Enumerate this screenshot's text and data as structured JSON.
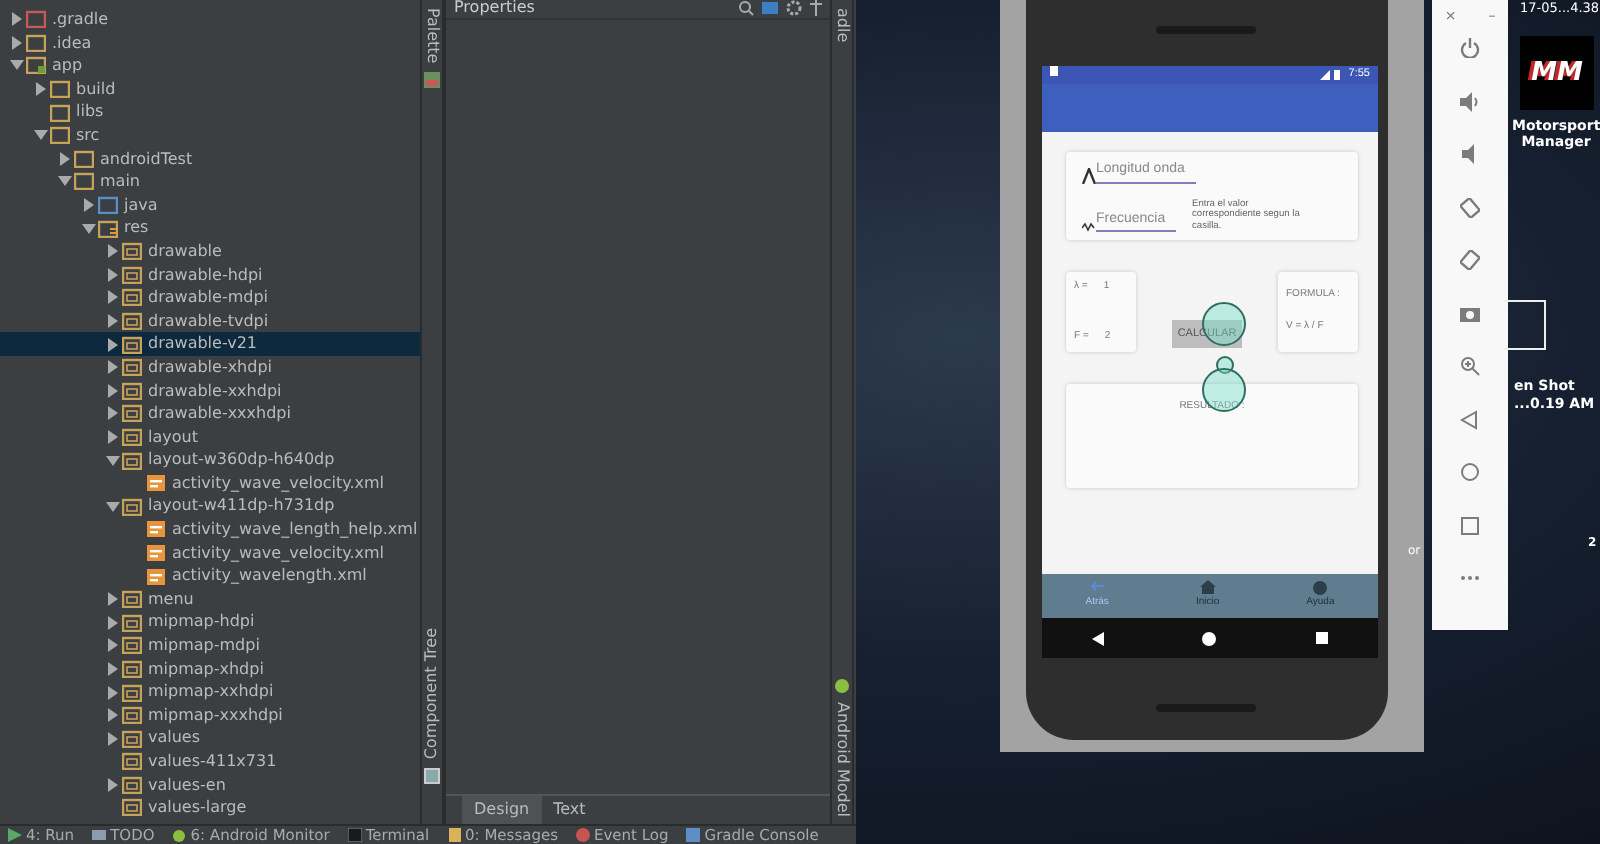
{
  "project_tree": [
    {
      "label": ".gradle",
      "kind": "gradle-folder",
      "expandable": true,
      "expanded": false,
      "selected": false
    },
    {
      "label": ".idea",
      "kind": "folder",
      "expandable": true,
      "expanded": false,
      "selected": false
    },
    {
      "label": "app",
      "kind": "module",
      "expandable": true,
      "expanded": true,
      "selected": false,
      "children": [
        {
          "label": "build",
          "kind": "folder",
          "expandable": true,
          "expanded": false,
          "selected": false
        },
        {
          "label": "libs",
          "kind": "folder",
          "expandable": false,
          "selected": false
        },
        {
          "label": "src",
          "kind": "folder",
          "expandable": true,
          "expanded": true,
          "selected": false,
          "children": [
            {
              "label": "androidTest",
              "kind": "folder",
              "expandable": true,
              "expanded": false,
              "selected": false
            },
            {
              "label": "main",
              "kind": "folder",
              "expandable": true,
              "expanded": true,
              "selected": false,
              "children": [
                {
                  "label": "java",
                  "kind": "source-folder",
                  "expandable": true,
                  "expanded": false,
                  "selected": false
                },
                {
                  "label": "res",
                  "kind": "resource-folder",
                  "expandable": true,
                  "expanded": true,
                  "selected": false,
                  "children": [
                    {
                      "label": "drawable",
                      "kind": "package",
                      "expandable": true,
                      "expanded": false,
                      "selected": false
                    },
                    {
                      "label": "drawable-hdpi",
                      "kind": "package",
                      "expandable": true,
                      "expanded": false,
                      "selected": false
                    },
                    {
                      "label": "drawable-mdpi",
                      "kind": "package",
                      "expandable": true,
                      "expanded": false,
                      "selected": false
                    },
                    {
                      "label": "drawable-tvdpi",
                      "kind": "package",
                      "expandable": true,
                      "expanded": false,
                      "selected": false
                    },
                    {
                      "label": "drawable-v21",
                      "kind": "package",
                      "expandable": true,
                      "expanded": false,
                      "selected": true
                    },
                    {
                      "label": "drawable-xhdpi",
                      "kind": "package",
                      "expandable": true,
                      "expanded": false,
                      "selected": false
                    },
                    {
                      "label": "drawable-xxhdpi",
                      "kind": "package",
                      "expandable": true,
                      "expanded": false,
                      "selected": false
                    },
                    {
                      "label": "drawable-xxxhdpi",
                      "kind": "package",
                      "expandable": true,
                      "expanded": false,
                      "selected": false
                    },
                    {
                      "label": "layout",
                      "kind": "package",
                      "expandable": true,
                      "expanded": false,
                      "selected": false
                    },
                    {
                      "label": "layout-w360dp-h640dp",
                      "kind": "package",
                      "expandable": true,
                      "expanded": true,
                      "selected": false,
                      "children": [
                        {
                          "label": "activity_wave_velocity.xml",
                          "kind": "xml-file",
                          "expandable": false,
                          "selected": false
                        }
                      ]
                    },
                    {
                      "label": "layout-w411dp-h731dp",
                      "kind": "package",
                      "expandable": true,
                      "expanded": true,
                      "selected": false,
                      "children": [
                        {
                          "label": "activity_wave_length_help.xml",
                          "kind": "xml-file",
                          "expandable": false,
                          "selected": false
                        },
                        {
                          "label": "activity_wave_velocity.xml",
                          "kind": "xml-file",
                          "expandable": false,
                          "selected": false
                        },
                        {
                          "label": "activity_wavelength.xml",
                          "kind": "xml-file",
                          "expandable": false,
                          "selected": false
                        }
                      ]
                    },
                    {
                      "label": "menu",
                      "kind": "package",
                      "expandable": true,
                      "expanded": false,
                      "selected": false
                    },
                    {
                      "label": "mipmap-hdpi",
                      "kind": "package",
                      "expandable": true,
                      "expanded": false,
                      "selected": false
                    },
                    {
                      "label": "mipmap-mdpi",
                      "kind": "package",
                      "expandable": true,
                      "expanded": false,
                      "selected": false
                    },
                    {
                      "label": "mipmap-xhdpi",
                      "kind": "package",
                      "expandable": true,
                      "expanded": false,
                      "selected": false
                    },
                    {
                      "label": "mipmap-xxhdpi",
                      "kind": "package",
                      "expandable": true,
                      "expanded": false,
                      "selected": false
                    },
                    {
                      "label": "mipmap-xxxhdpi",
                      "kind": "package",
                      "expandable": true,
                      "expanded": false,
                      "selected": false
                    },
                    {
                      "label": "values",
                      "kind": "package",
                      "expandable": true,
                      "expanded": false,
                      "selected": false
                    },
                    {
                      "label": "values-411x731",
                      "kind": "package",
                      "expandable": false,
                      "selected": false
                    },
                    {
                      "label": "values-en",
                      "kind": "package",
                      "expandable": true,
                      "expanded": false,
                      "selected": false
                    },
                    {
                      "label": "values-large",
                      "kind": "package",
                      "expandable": false,
                      "selected": false
                    }
                  ]
                }
              ]
            }
          ]
        }
      ]
    }
  ],
  "tool_strips": {
    "left": [
      "Palette",
      "Component Tree"
    ],
    "right": [
      "adle",
      "Android Model"
    ]
  },
  "properties_panel": {
    "title": "Properties",
    "tabs": [
      {
        "label": "Design",
        "selected": true
      },
      {
        "label": "Text",
        "selected": false
      }
    ]
  },
  "status_bar": [
    {
      "label": "4: Run",
      "kind": "run"
    },
    {
      "label": "TODO",
      "kind": "todo"
    },
    {
      "label": "6: Android Monitor",
      "kind": "android"
    },
    {
      "label": "Terminal",
      "kind": "terminal"
    },
    {
      "label": "0: Messages",
      "kind": "messages"
    },
    {
      "label": "Event Log",
      "kind": "event-log"
    },
    {
      "label": "Gradle Console",
      "kind": "gradle"
    }
  ],
  "emulator": {
    "controls": [
      "×",
      "–"
    ],
    "phone": {
      "time": "7:55",
      "wavelength_field": {
        "placeholder": "Longitud onda"
      },
      "frequency_field": {
        "placeholder": "Frecuencia"
      },
      "hint": "Entra el valor correspondiente segun la casilla.",
      "inputs": [
        {
          "label": "λ =",
          "value": "1"
        },
        {
          "label": "F =",
          "value": "2"
        }
      ],
      "formula_title": "FORMULA :",
      "formula": "V = λ / F",
      "button": "CALCULAR",
      "result_label": "RESULTADO :",
      "bottom_nav": [
        {
          "label": "Atrás",
          "kind": "back",
          "selected": true
        },
        {
          "label": "Inicio",
          "kind": "home",
          "selected": false
        },
        {
          "label": "Ayuda",
          "kind": "help",
          "selected": false
        }
      ]
    }
  },
  "desktop": {
    "top_caption": "17-05...4.38",
    "app_logo": "MM",
    "app_name": "Motorsport Manager",
    "file_captions": [
      "en Shot",
      "...0.19 AM"
    ],
    "edge_texts": [
      "or",
      "2"
    ]
  }
}
